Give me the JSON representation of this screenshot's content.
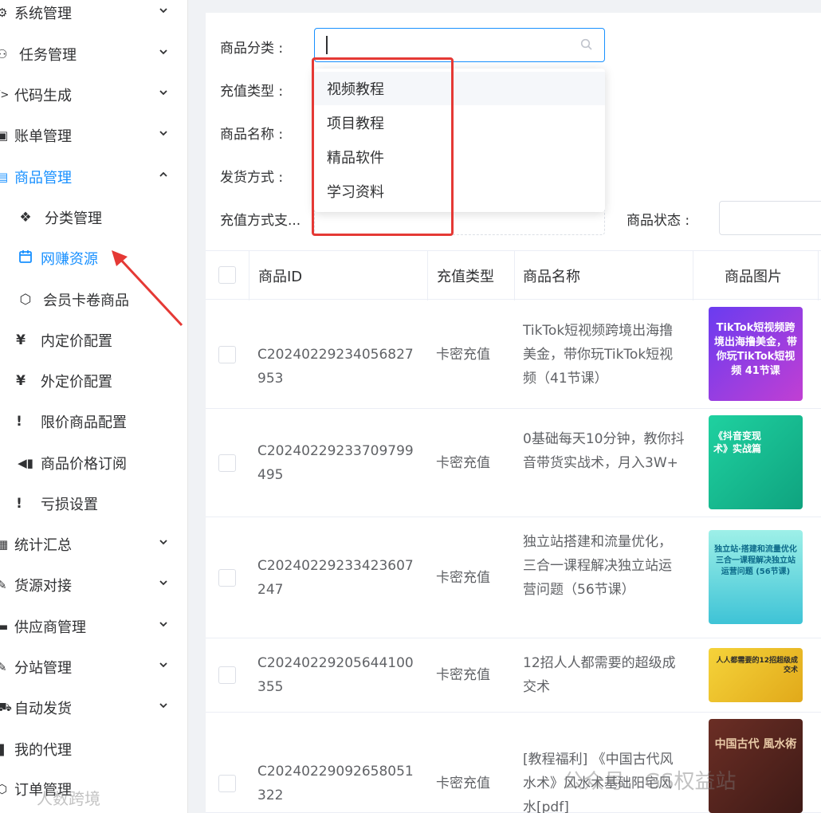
{
  "sidebar": {
    "menu": [
      {
        "label": "系统管理",
        "icon": "gear-icon",
        "glyph": "⚙"
      },
      {
        "label": "任务管理",
        "icon": "tasks-icon",
        "glyph": "⚇"
      },
      {
        "label": "代码生成",
        "icon": "code-icon",
        "glyph": "</>"
      },
      {
        "label": "账单管理",
        "icon": "bill-icon",
        "glyph": "▣"
      },
      {
        "label": "商品管理",
        "icon": "clipboard-icon",
        "glyph": "▤"
      }
    ],
    "sub": [
      {
        "label": "分类管理",
        "icon": "cubes-icon",
        "glyph": "❖"
      },
      {
        "label": "网赚资源",
        "icon": "calendar-icon",
        "glyph": "▭"
      },
      {
        "label": "会员卡卷商品",
        "icon": "hexagon-icon",
        "glyph": "⬡"
      },
      {
        "label": "内定价配置",
        "icon": "yen-icon",
        "glyph": "¥"
      },
      {
        "label": "外定价配置",
        "icon": "yen-icon",
        "glyph": "¥"
      },
      {
        "label": "限价商品配置",
        "icon": "exclamation-icon",
        "glyph": "!"
      },
      {
        "label": "商品价格订阅",
        "icon": "megaphone-icon",
        "glyph": "📢"
      },
      {
        "label": "亏损设置",
        "icon": "exclamation-icon",
        "glyph": "!"
      }
    ],
    "menu2": [
      {
        "label": "统计汇总",
        "icon": "table-icon",
        "glyph": "▦"
      },
      {
        "label": "货源对接",
        "icon": "link-icon",
        "glyph": "✎"
      },
      {
        "label": "供应商管理",
        "icon": "box-icon",
        "glyph": "▬"
      },
      {
        "label": "分站管理",
        "icon": "sites-icon",
        "glyph": "✎"
      },
      {
        "label": "自动发货",
        "icon": "truck-icon",
        "glyph": "⛟"
      },
      {
        "label": "我的代理",
        "icon": "agent-icon",
        "glyph": "❚"
      },
      {
        "label": "订单管理",
        "icon": "order-icon",
        "glyph": "⬡"
      }
    ]
  },
  "form": {
    "category_label": "商品分类 :",
    "recharge_type_label": "充值类型 :",
    "product_name_label": "商品名称 :",
    "delivery_label": "发货方式 :",
    "recharge_method_label": "充值方式支...",
    "status_label": "商品状态 :"
  },
  "dropdown": {
    "options": [
      "视频教程",
      "项目教程",
      "精品软件",
      "学习资料"
    ]
  },
  "table": {
    "headers": [
      "商品ID",
      "充值类型",
      "商品名称",
      "商品图片"
    ],
    "rows": [
      {
        "id": "C20240229234056827953",
        "type": "卡密充值",
        "name": "TikTok短视频跨境出海撸美金，带你玩TikTok短视频（41节课）",
        "thumb_text": "TikTok短视频跨境出海撸美金，带你玩TikTok短视频 41节课",
        "color": "#5b3fd6"
      },
      {
        "id": "C20240229233709799495",
        "type": "卡密充值",
        "name": "0基础每天10分钟，教你抖音带货实战术，月入3W+",
        "thumb_text": "《抖音变现术》实战篇",
        "color": "#17b890"
      },
      {
        "id": "C20240229233423607247",
        "type": "卡密充值",
        "name": "独立站搭建和流量优化，三合一课程解决独立站运营问题（56节课）",
        "thumb_text": "独立站·搭建和流量优化 三合一课程解决独立站运营问题 (56节课)",
        "color": "#4fc7d6"
      },
      {
        "id": "C20240229205644100355",
        "type": "卡密充值",
        "name": "12招人人都需要的超级成交术",
        "thumb_text": "人人都需要的12招超级成交术",
        "color": "#e8c22a"
      },
      {
        "id": "C20240229092658051322",
        "type": "卡密充值",
        "name": "[教程福利] 《中国古代风水术》风水术基础阳宅风水[pdf]",
        "thumb_text": "中国古代 風水術",
        "color": "#5a2a22"
      }
    ]
  },
  "watermarks": {
    "left": "人数跨境",
    "right": "公众号 · GS权益站"
  },
  "colors": {
    "accent": "#1890ff",
    "highlight": "#e53935"
  }
}
